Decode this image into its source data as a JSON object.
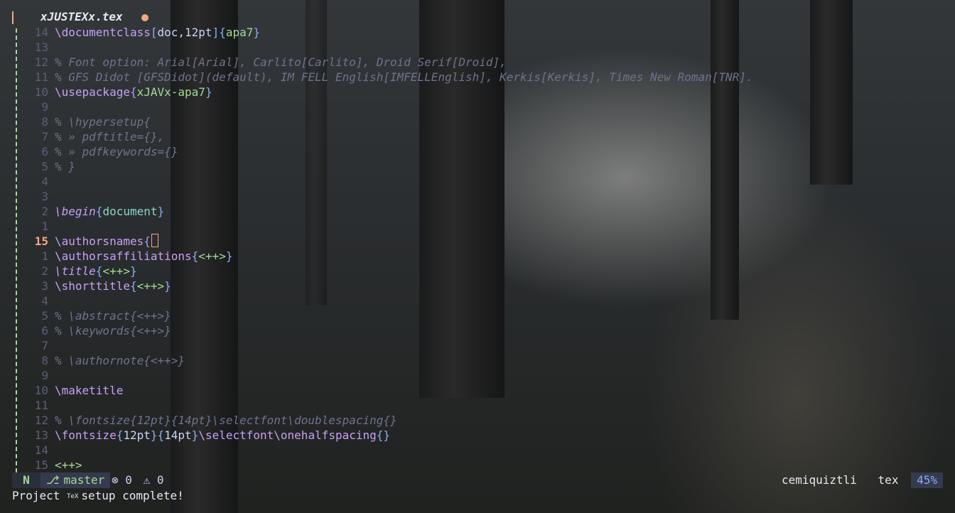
{
  "tab": {
    "title": "xJUSTEXx.tex"
  },
  "lines": [
    {
      "num": "14",
      "cur": false,
      "segments": [
        {
          "c": "c-cmd",
          "t": "\\documentclass"
        },
        {
          "c": "c-brace",
          "t": "["
        },
        {
          "c": "c-plain",
          "t": "doc,12pt"
        },
        {
          "c": "c-brace",
          "t": "]{"
        },
        {
          "c": "c-arg",
          "t": "apa7"
        },
        {
          "c": "c-brace",
          "t": "}"
        }
      ]
    },
    {
      "num": "13",
      "cur": false,
      "segments": []
    },
    {
      "num": "12",
      "cur": false,
      "segments": [
        {
          "c": "c-comment",
          "t": "% Font option: Arial[Arial], Carlito[Carlito], Droid Serif[Droid],"
        }
      ]
    },
    {
      "num": "11",
      "cur": false,
      "segments": [
        {
          "c": "c-comment",
          "t": "% GFS Didot [GFSDidot](default), IM FELL English[IMFELLEnglish], Kerkis[Kerkis], Times New Roman[TNR]."
        }
      ]
    },
    {
      "num": "10",
      "cur": false,
      "segments": [
        {
          "c": "c-cmd",
          "t": "\\usepackage"
        },
        {
          "c": "c-brace",
          "t": "{"
        },
        {
          "c": "c-arg",
          "t": "xJAVx-apa7"
        },
        {
          "c": "c-brace",
          "t": "}"
        }
      ]
    },
    {
      "num": "9",
      "cur": false,
      "segments": []
    },
    {
      "num": "8",
      "cur": false,
      "segments": [
        {
          "c": "c-comment",
          "t": "% \\hypersetup{"
        }
      ]
    },
    {
      "num": "7",
      "cur": false,
      "segments": [
        {
          "c": "c-comment",
          "t": "% » pdftitle={},"
        }
      ]
    },
    {
      "num": "6",
      "cur": false,
      "segments": [
        {
          "c": "c-comment",
          "t": "% » pdfkeywords={}"
        }
      ]
    },
    {
      "num": "5",
      "cur": false,
      "segments": [
        {
          "c": "c-comment",
          "t": "% }"
        }
      ]
    },
    {
      "num": "4",
      "cur": false,
      "segments": []
    },
    {
      "num": "3",
      "cur": false,
      "segments": []
    },
    {
      "num": "2",
      "cur": false,
      "segments": [
        {
          "c": "c-ital",
          "t": "\\begin"
        },
        {
          "c": "c-brace",
          "t": "{"
        },
        {
          "c": "c-env",
          "t": "document"
        },
        {
          "c": "c-brace",
          "t": "}"
        }
      ]
    },
    {
      "num": "1",
      "cur": false,
      "segments": []
    },
    {
      "num": "15",
      "cur": true,
      "segments": [
        {
          "c": "c-cmd",
          "t": "\\authorsnames"
        },
        {
          "c": "c-brace",
          "t": "{"
        },
        {
          "c": "cursor",
          "t": ""
        }
      ]
    },
    {
      "num": "1",
      "cur": false,
      "segments": [
        {
          "c": "c-cmd",
          "t": "\\authorsaffiliations"
        },
        {
          "c": "c-brace",
          "t": "{"
        },
        {
          "c": "c-ph",
          "t": "<++>"
        },
        {
          "c": "c-brace",
          "t": "}"
        }
      ]
    },
    {
      "num": "2",
      "cur": false,
      "segments": [
        {
          "c": "c-ital",
          "t": "\\title"
        },
        {
          "c": "c-brace",
          "t": "{"
        },
        {
          "c": "c-ph",
          "t": "<++>"
        },
        {
          "c": "c-brace",
          "t": "}"
        }
      ]
    },
    {
      "num": "3",
      "cur": false,
      "segments": [
        {
          "c": "c-cmd",
          "t": "\\shorttitle"
        },
        {
          "c": "c-brace",
          "t": "{"
        },
        {
          "c": "c-ph",
          "t": "<++>"
        },
        {
          "c": "c-brace",
          "t": "}"
        }
      ]
    },
    {
      "num": "4",
      "cur": false,
      "segments": []
    },
    {
      "num": "5",
      "cur": false,
      "segments": [
        {
          "c": "c-comment",
          "t": "% \\abstract{<++>}"
        }
      ]
    },
    {
      "num": "6",
      "cur": false,
      "segments": [
        {
          "c": "c-comment",
          "t": "% \\keywords{<++>}"
        }
      ]
    },
    {
      "num": "7",
      "cur": false,
      "segments": []
    },
    {
      "num": "8",
      "cur": false,
      "segments": [
        {
          "c": "c-comment",
          "t": "% \\authornote{<++>}"
        }
      ]
    },
    {
      "num": "9",
      "cur": false,
      "segments": []
    },
    {
      "num": "10",
      "cur": false,
      "segments": [
        {
          "c": "c-cmd",
          "t": "\\maketitle"
        }
      ]
    },
    {
      "num": "11",
      "cur": false,
      "segments": []
    },
    {
      "num": "12",
      "cur": false,
      "segments": [
        {
          "c": "c-comment",
          "t": "% \\fontsize{12pt}{14pt}\\selectfont\\doublespacing{}"
        }
      ]
    },
    {
      "num": "13",
      "cur": false,
      "segments": [
        {
          "c": "c-cmd",
          "t": "\\fontsize"
        },
        {
          "c": "c-brace",
          "t": "{"
        },
        {
          "c": "c-plain",
          "t": "12pt"
        },
        {
          "c": "c-brace",
          "t": "}{"
        },
        {
          "c": "c-plain",
          "t": "14pt"
        },
        {
          "c": "c-brace",
          "t": "}"
        },
        {
          "c": "c-cmd",
          "t": "\\selectfont\\onehalfspacing"
        },
        {
          "c": "c-brace",
          "t": "{}"
        }
      ]
    },
    {
      "num": "14",
      "cur": false,
      "segments": []
    },
    {
      "num": "15",
      "cur": false,
      "segments": [
        {
          "c": "c-ph",
          "t": "<++>"
        }
      ]
    }
  ],
  "statusline": {
    "mode": "N",
    "branch_icon": "git-branch-icon",
    "branch": "master",
    "errors": "0",
    "warnings": "0",
    "user": "cemiquiztli",
    "filetype": "tex",
    "progress": "45%"
  },
  "message": "Project ",
  "message_icon": "TeX",
  "message_tail": "setup complete!",
  "colors": {
    "accent": "#f5a97f",
    "green": "#a6da95",
    "purple": "#c6a0f6",
    "blue": "#8aadf4"
  }
}
